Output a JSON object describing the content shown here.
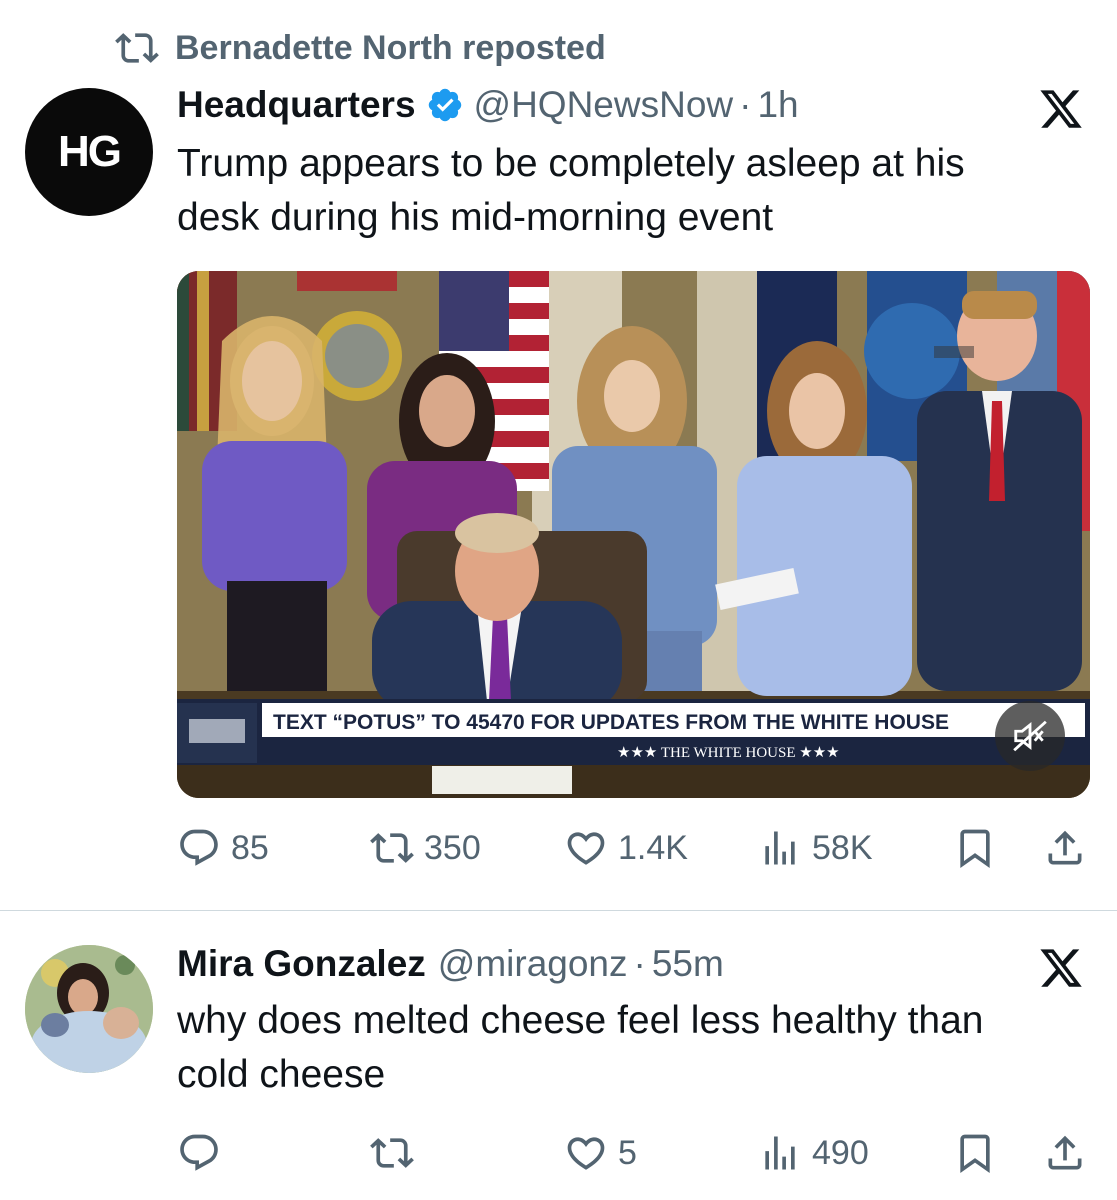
{
  "repost": {
    "icon": "repost-icon",
    "text": "Bernadette North reposted"
  },
  "tweet1": {
    "avatar_text": "HG",
    "name": "Headquarters",
    "handle": "@HQNewsNow",
    "separator": "·",
    "time": "1h",
    "text_line1": "Trump appears to be completely asleep at his",
    "text_line2": "desk during his mid-morning event",
    "media": {
      "banner_text": "TEXT “POTUS” TO 45470 FOR UPDATES FROM THE WHITE HOUSE",
      "banner_sub": "★★★  THE WHITE HOUSE  ★★★",
      "mute_icon": "muted-speaker-icon"
    },
    "actions": {
      "replies": "85",
      "reposts": "350",
      "likes": "1.4K",
      "views": "58K"
    }
  },
  "tweet2": {
    "name": "Mira Gonzalez",
    "handle": "@miragonz",
    "separator": "·",
    "time": "55m",
    "text_line1": "why does melted cheese feel less healthy than",
    "text_line2": "cold cheese",
    "actions": {
      "replies": "",
      "reposts": "",
      "likes": "5",
      "views": "490"
    }
  },
  "colors": {
    "text": "#0f1419",
    "muted": "#536471",
    "verified": "#1d9bf0",
    "divider": "#cfd9de"
  }
}
